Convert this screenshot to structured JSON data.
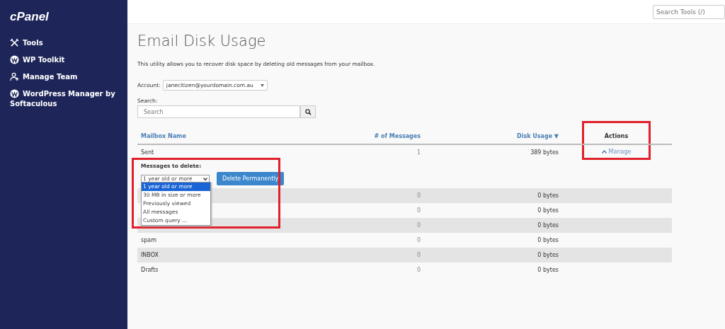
{
  "sidebar": {
    "logo": "cPanel",
    "items": [
      {
        "kind": "tools",
        "label": "Tools"
      },
      {
        "kind": "wordpress",
        "label": "WP Toolkit"
      },
      {
        "kind": "team",
        "label": "Manage Team"
      },
      {
        "kind": "wordpress",
        "label": "WordPress Manager by Softaculous"
      }
    ]
  },
  "topbar": {
    "search": {
      "placeholder": "Search Tools (/)"
    }
  },
  "page": {
    "title": "Email Disk Usage",
    "description": "This utility allows you to recover disk space by deleting old messages from your mailbox.",
    "account": {
      "label": "Account:",
      "value": "janecitizen@yourdomain.com.au"
    },
    "search": {
      "label": "Search:",
      "placeholder": "Search"
    }
  },
  "table": {
    "columns": [
      "Mailbox Name",
      "# of Messages",
      "Disk Usage ▼",
      "Actions"
    ],
    "actions_highlighted": true,
    "rows": [
      {
        "name": "Sent",
        "messages": "1",
        "usage": "389 bytes",
        "action": "Manage",
        "expanded": true
      },
      {
        "messages": "0",
        "usage": "0 bytes"
      },
      {
        "messages": "0",
        "usage": "0 bytes"
      },
      {
        "messages": "0",
        "usage": "0 bytes"
      },
      {
        "name": "spam",
        "messages": "0",
        "usage": "0 bytes"
      },
      {
        "name": "INBOX",
        "messages": "0",
        "usage": "0 bytes"
      },
      {
        "name": "Drafts",
        "messages": "0",
        "usage": "0 bytes"
      }
    ]
  },
  "delete_panel": {
    "label": "Messages to delete:",
    "highlighted": true,
    "select": {
      "value": "1 year old or more",
      "open": true,
      "options": [
        {
          "label": "1 year old or more",
          "selected": true
        },
        {
          "label": "30 MB in size or more",
          "selected": false
        },
        {
          "label": "Previously viewed",
          "selected": false
        },
        {
          "label": "All messages",
          "selected": false
        },
        {
          "label": "Custom query ...",
          "selected": false
        }
      ]
    },
    "button": "Delete Permanently"
  }
}
